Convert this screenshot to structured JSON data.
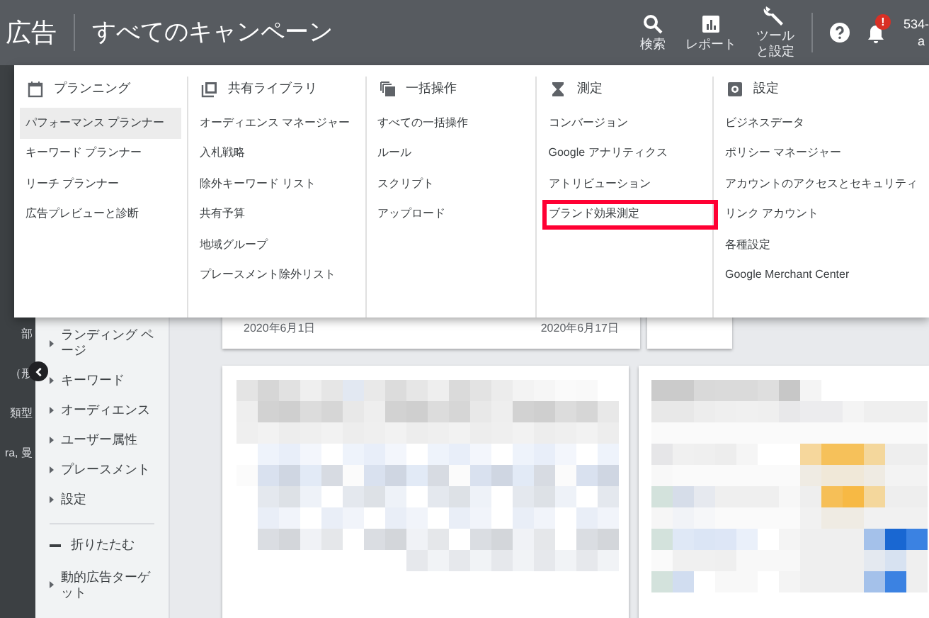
{
  "top_bar": {
    "product": "広告",
    "title": "すべてのキャンペーン",
    "actions": [
      {
        "kind": "search",
        "label": "検索"
      },
      {
        "kind": "report",
        "label": "レポート"
      },
      {
        "kind": "tools",
        "label": "ツール",
        "label_line_2": "と設定"
      }
    ],
    "notification_badge": "!",
    "account": "534-",
    "account_line_2": "a"
  },
  "menu": {
    "columns": [
      {
        "kind": "calendar",
        "heading": "プランニング",
        "items": [
          {
            "label": "パフォーマンス プランナー",
            "selected": true,
            "outlined": false
          },
          {
            "label": "キーワード プランナー",
            "selected": false,
            "outlined": false
          },
          {
            "label": "リーチ プランナー",
            "selected": false,
            "outlined": false
          },
          {
            "label": "広告プレビューと診断",
            "selected": false,
            "outlined": false
          }
        ]
      },
      {
        "kind": "library",
        "heading": "共有ライブラリ",
        "items": [
          {
            "label": "オーディエンス マネージャー",
            "selected": false,
            "outlined": false
          },
          {
            "label": "入札戦略",
            "selected": false,
            "outlined": false
          },
          {
            "label": "除外キーワード リスト",
            "selected": false,
            "outlined": false
          },
          {
            "label": "共有予算",
            "selected": false,
            "outlined": false
          },
          {
            "label": "地域グループ",
            "selected": false,
            "outlined": false
          },
          {
            "label": "プレースメント除外リスト",
            "selected": false,
            "outlined": false
          }
        ]
      },
      {
        "kind": "copy",
        "heading": "一括操作",
        "items": [
          {
            "label": "すべての一括操作",
            "selected": false,
            "outlined": false
          },
          {
            "label": "ルール",
            "selected": false,
            "outlined": false
          },
          {
            "label": "スクリプト",
            "selected": false,
            "outlined": false
          },
          {
            "label": "アップロード",
            "selected": false,
            "outlined": false
          }
        ]
      },
      {
        "kind": "hourglass",
        "heading": "測定",
        "items": [
          {
            "label": "コンバージョン",
            "selected": false,
            "outlined": false
          },
          {
            "label": "Google アナリティクス",
            "selected": false,
            "outlined": false
          },
          {
            "label": "アトリビューション",
            "selected": false,
            "outlined": false
          },
          {
            "label": "ブランド効果測定",
            "selected": false,
            "outlined": true
          }
        ]
      },
      {
        "kind": "gear",
        "heading": "設定",
        "items": [
          {
            "label": "ビジネスデータ",
            "selected": false,
            "outlined": false
          },
          {
            "label": "ポリシー マネージャー",
            "selected": false,
            "outlined": false
          },
          {
            "label": "アカウントのアクセスとセキュリティ",
            "selected": false,
            "outlined": false
          },
          {
            "label": "リンク アカウント",
            "selected": false,
            "outlined": false
          },
          {
            "label": "各種設定",
            "selected": false,
            "outlined": false
          },
          {
            "label": "Google Merchant Center",
            "selected": false,
            "outlined": false
          }
        ]
      }
    ]
  },
  "left_strip": [
    "部",
    "（形",
    "類型",
    "ra, 曼"
  ],
  "sidebar": {
    "items": [
      {
        "kind": "link",
        "label": "ランディング ページ"
      },
      {
        "kind": "link",
        "label": "キーワード"
      },
      {
        "kind": "link",
        "label": "オーディエンス"
      },
      {
        "kind": "link",
        "label": "ユーザー属性"
      },
      {
        "kind": "link",
        "label": "プレースメント"
      },
      {
        "kind": "link",
        "label": "設定"
      },
      {
        "kind": "collapse",
        "label": "折りたたむ"
      },
      {
        "kind": "link",
        "label": "動的広告ターゲット"
      }
    ]
  },
  "cards": {
    "dates": [
      "2020年6月1日",
      "2020年6月17日"
    ]
  }
}
